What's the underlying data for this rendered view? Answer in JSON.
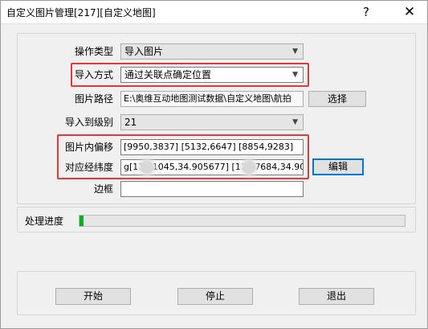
{
  "window": {
    "title": "自定义图片管理[217][自定义地图]",
    "help_glyph": "?",
    "close_glyph": "✕"
  },
  "form": {
    "operation_type": {
      "label": "操作类型",
      "value": "导入图片"
    },
    "import_method": {
      "label": "导入方式",
      "value": "通过关联点确定位置"
    },
    "image_path": {
      "label": "图片路径",
      "value": "E:\\奥维互动地图测试数据\\自定义地图\\航拍",
      "button": "选择"
    },
    "import_level": {
      "label": "导入到级别",
      "value": "21"
    },
    "pixel_offset": {
      "label": "图片内偏移",
      "value": "[9950,3837] [5132,6647] [8854,9283]"
    },
    "coordinates": {
      "label": "对应经纬度",
      "value": "g[11  51045,34.905677] [11  47684,34.90",
      "button": "编辑"
    },
    "border": {
      "label": "边框",
      "value": ""
    }
  },
  "progress": {
    "label": "处理进度",
    "fraction": 0.01,
    "fill_color": "#06b025"
  },
  "actions": {
    "start": "开始",
    "stop": "停止",
    "exit": "退出"
  },
  "colors": {
    "highlight": "#e0393e",
    "focus": "#0078d7"
  },
  "icons": {
    "dropdown": "chevron-down-icon"
  }
}
